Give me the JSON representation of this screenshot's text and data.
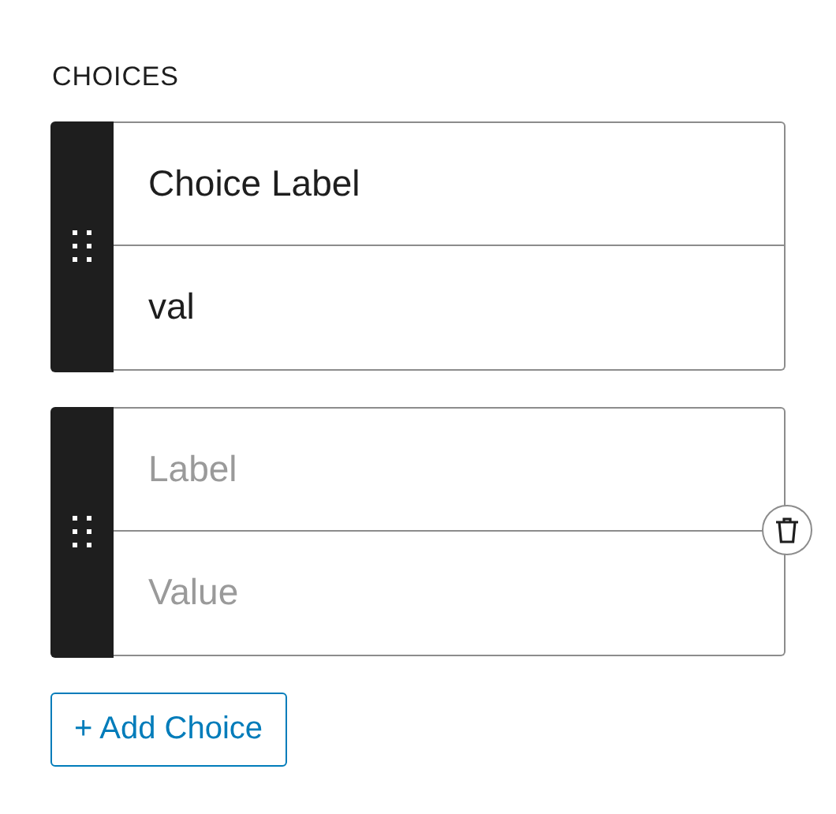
{
  "heading": "CHOICES",
  "choices": [
    {
      "label": {
        "value": "Choice Label"
      },
      "value": {
        "value": "val"
      },
      "show_delete": false
    },
    {
      "label": {
        "placeholder": "Label"
      },
      "value": {
        "placeholder": "Value"
      },
      "show_delete": true
    }
  ],
  "add_button": "+ Add Choice"
}
